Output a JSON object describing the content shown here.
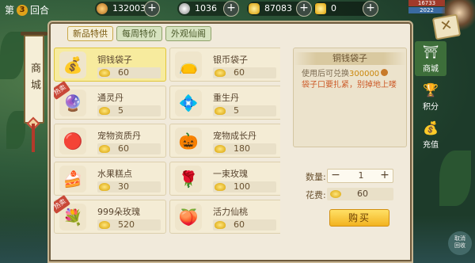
{
  "top": {
    "round_prefix": "第",
    "round_num": "3",
    "round_suffix": "回合",
    "currencies": [
      {
        "name": "coin",
        "value": "1320032",
        "icon": "copper-coin-icon"
      },
      {
        "name": "silver",
        "value": "1036",
        "icon": "silver-coin-icon"
      },
      {
        "name": "gold-ingot",
        "value": "87083",
        "icon": "gold-ingot-icon"
      },
      {
        "name": "ingot-box",
        "value": "0",
        "icon": "treasure-ingot-icon"
      }
    ],
    "hp_top": "16733",
    "hp_bottom": "2022"
  },
  "tabs": [
    "新品特供",
    "每周特价",
    "外观仙阁"
  ],
  "banner": "商城",
  "items": [
    {
      "name": "铜钱袋子",
      "price": "60",
      "icon": "money-bag-icon",
      "hot": false,
      "selected": true
    },
    {
      "name": "银币袋子",
      "price": "60",
      "icon": "silver-bag-icon",
      "hot": false
    },
    {
      "name": "通灵丹",
      "price": "5",
      "icon": "spirit-orb-icon",
      "hot": true
    },
    {
      "name": "重生丹",
      "price": "5",
      "icon": "rebirth-pill-icon",
      "hot": false
    },
    {
      "name": "宠物资质丹",
      "price": "60",
      "icon": "pet-pill-icon",
      "hot": false
    },
    {
      "name": "宠物成长丹",
      "price": "180",
      "icon": "growth-pill-icon",
      "hot": false
    },
    {
      "name": "水果糕点",
      "price": "30",
      "icon": "fruit-cake-icon",
      "hot": false
    },
    {
      "name": "一束玫瑰",
      "price": "100",
      "icon": "rose-icon",
      "hot": false
    },
    {
      "name": "999朵玫瑰",
      "price": "520",
      "icon": "rose-bouquet-icon",
      "hot": true
    },
    {
      "name": "活力仙桃",
      "price": "60",
      "icon": "peach-icon",
      "hot": false
    }
  ],
  "hot_label": "热卖",
  "detail": {
    "title": "铜钱袋子",
    "desc_prefix": "使用后可兑换",
    "desc_amount": "300000",
    "desc_warn": "袋子口要扎紧，别掉地上喽"
  },
  "quantity_label": "数量:",
  "quantity": "1",
  "cost_label": "花费:",
  "cost": "60",
  "buy_label": "购买",
  "right_nav": [
    {
      "label": "商城",
      "icon": "shop-icon",
      "active": true
    },
    {
      "label": "积分",
      "icon": "points-icon",
      "active": false
    },
    {
      "label": "充值",
      "icon": "recharge-icon",
      "active": false
    }
  ],
  "corner": "取消\n回收"
}
